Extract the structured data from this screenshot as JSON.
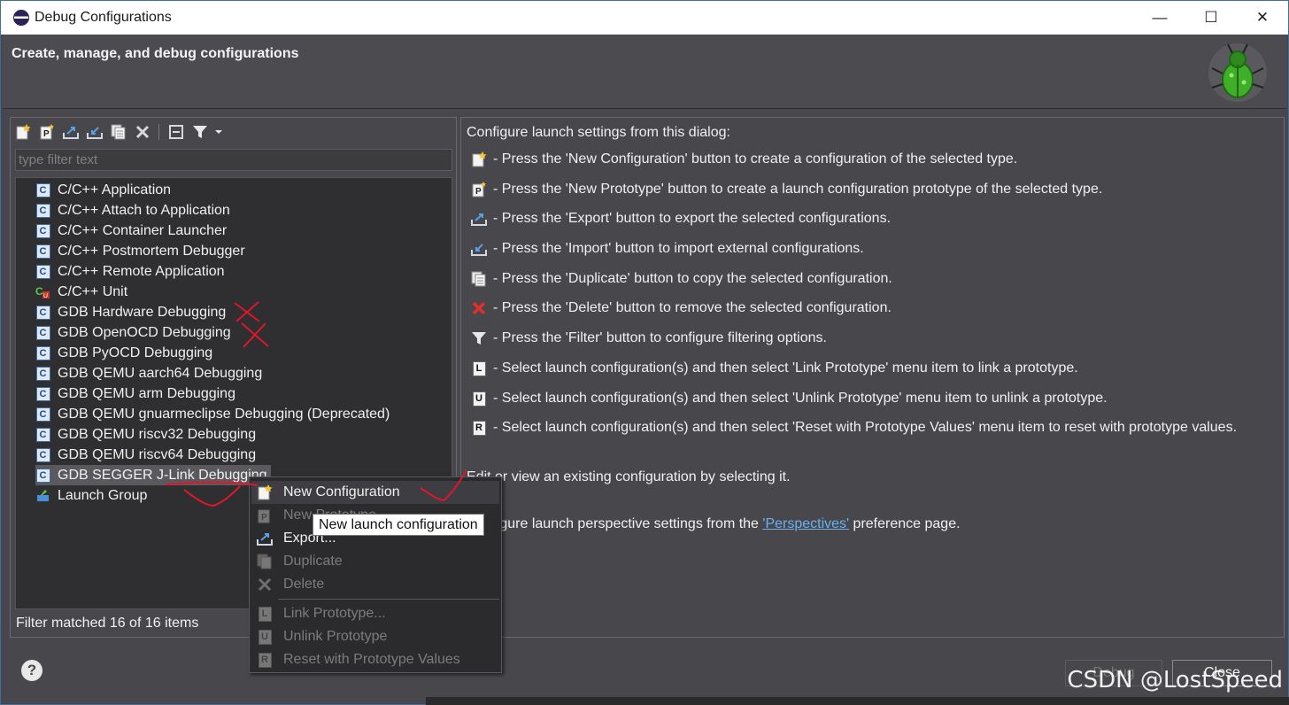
{
  "window": {
    "title": "Debug Configurations",
    "controls": {
      "minimize": "—",
      "maximize": "☐",
      "close": "✕"
    }
  },
  "header": {
    "heading": "Create, manage, and debug configurations"
  },
  "left": {
    "filter_placeholder": "type filter text",
    "items": [
      {
        "label": "C/C++ Application",
        "icon": "c-icon"
      },
      {
        "label": "C/C++ Attach to Application",
        "icon": "c-icon"
      },
      {
        "label": "C/C++ Container Launcher",
        "icon": "c-icon"
      },
      {
        "label": "C/C++ Postmortem Debugger",
        "icon": "c-icon"
      },
      {
        "label": "C/C++ Remote Application",
        "icon": "c-icon"
      },
      {
        "label": "C/C++ Unit",
        "icon": "unit-icon"
      },
      {
        "label": "GDB Hardware Debugging",
        "icon": "c-icon"
      },
      {
        "label": "GDB OpenOCD Debugging",
        "icon": "c-icon"
      },
      {
        "label": "GDB PyOCD Debugging",
        "icon": "c-icon"
      },
      {
        "label": "GDB QEMU aarch64 Debugging",
        "icon": "c-icon"
      },
      {
        "label": "GDB QEMU arm Debugging",
        "icon": "c-icon"
      },
      {
        "label": "GDB QEMU gnuarmeclipse Debugging (Deprecated)",
        "icon": "c-icon"
      },
      {
        "label": "GDB QEMU riscv32 Debugging",
        "icon": "c-icon"
      },
      {
        "label": "GDB QEMU riscv64 Debugging",
        "icon": "c-icon"
      },
      {
        "label": "GDB SEGGER J-Link Debugging",
        "icon": "c-icon"
      },
      {
        "label": "Launch Group",
        "icon": "launch-group-icon"
      }
    ],
    "status": "Filter matched 16 of 16 items"
  },
  "right": {
    "intro": "Configure launch settings from this dialog:",
    "help": [
      {
        "icon": "new-config-icon",
        "text": "- Press the 'New Configuration' button to create a configuration of the selected type."
      },
      {
        "icon": "new-prototype-icon",
        "text": "- Press the 'New Prototype' button to create a launch configuration prototype of the selected type."
      },
      {
        "icon": "export-icon",
        "text": "- Press the 'Export' button to export the selected configurations."
      },
      {
        "icon": "import-icon",
        "text": "- Press the 'Import' button to import external configurations."
      },
      {
        "icon": "duplicate-icon",
        "text": "- Press the 'Duplicate' button to copy the selected configuration."
      },
      {
        "icon": "delete-icon",
        "text": "- Press the 'Delete' button to remove the selected configuration."
      },
      {
        "icon": "filter-icon",
        "text": "- Press the 'Filter' button to configure filtering options."
      },
      {
        "icon": "link-prototype-icon",
        "letter": "L",
        "text": "- Select launch configuration(s) and then select 'Link Prototype' menu item to link a prototype."
      },
      {
        "icon": "unlink-prototype-icon",
        "letter": "U",
        "text": "- Select launch configuration(s) and then select 'Unlink Prototype' menu item to unlink a prototype."
      },
      {
        "icon": "reset-prototype-icon",
        "letter": "R",
        "text": "- Select launch configuration(s) and then select 'Reset with Prototype Values' menu item to reset with prototype values."
      }
    ],
    "edit_text": "Edit or view an existing configuration by selecting it.",
    "perspectives_before": "Configure launch perspective settings from the ",
    "perspectives_link": "'Perspectives'",
    "perspectives_after": " preference page."
  },
  "context_menu": {
    "new_configuration": "New Configuration",
    "new_prototype": "New Prototype",
    "export": "Export...",
    "duplicate": "Duplicate",
    "delete": "Delete",
    "link_prototype": "Link Prototype...",
    "unlink_prototype": "Unlink Prototype",
    "reset_prototype": "Reset with Prototype Values"
  },
  "tooltip": "New launch configuration",
  "footer": {
    "help": "?",
    "debug_button": "Debug",
    "close_button": "Close"
  },
  "watermark": "CSDN @LostSpeed",
  "colors": {
    "dialog_bg": "#48484c",
    "tree_bg": "#2f2f31",
    "link": "#6ab0f0",
    "annotation": "#e0162b"
  }
}
